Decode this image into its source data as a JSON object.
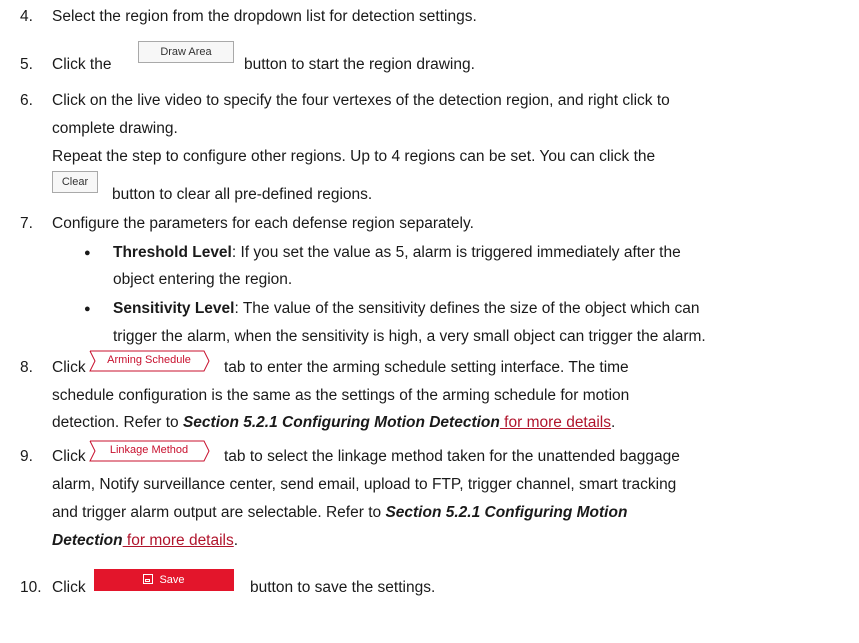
{
  "steps": {
    "s4": {
      "num": "4.",
      "text": "Select the region from the dropdown list for detection settings."
    },
    "s5": {
      "num": "5.",
      "pre": "Click the",
      "button": "Draw Area",
      "post": "button to start the region drawing."
    },
    "s6": {
      "num": "6.",
      "line1": "Click on the live video to specify the four vertexes of the detection region, and right click to",
      "line2": "complete drawing.",
      "line3": "Repeat the step to configure other regions. Up to 4 regions can be set. You can click the",
      "clear_button": "Clear",
      "line4": "button to clear all pre-defined regions."
    },
    "s7": {
      "num": "7.",
      "text": "Configure the parameters for each defense region separately.",
      "bullets": [
        {
          "term": "Threshold Level",
          "line1": ": If you set the value as 5, alarm is triggered immediately after the",
          "line2": "object entering the region."
        },
        {
          "term": "Sensitivity Level",
          "line1": ": The value of the sensitivity defines the size of the object which can",
          "line2": "trigger the alarm, when the sensitivity is high, a very small object can trigger the alarm."
        }
      ]
    },
    "s8": {
      "num": "8.",
      "pre": "Click",
      "tab": "Arming Schedule",
      "line1": "tab to enter the arming schedule setting interface. The time",
      "line2": "schedule configuration is the same as the settings of the arming schedule for motion",
      "line3_pre": "detection. Refer to ",
      "ref": "Section 5.2.1 Configuring Motion Detection",
      "link": " for more details",
      "end": "."
    },
    "s9": {
      "num": "9.",
      "pre": "Click",
      "tab": "Linkage Method",
      "line1": "tab to select the linkage method taken for the unattended baggage",
      "line2": "alarm, Notify surveillance center, send email, upload to FTP, trigger channel, smart tracking",
      "line3_pre": "and trigger alarm output are selectable. Refer to ",
      "ref_a": "Section 5.2.1 Configuring Motion",
      "ref_b": "Detection",
      "link": " for more details",
      "end": "."
    },
    "s10": {
      "num": "10.",
      "pre": "Click",
      "button": "Save",
      "button_icon": "save-icon",
      "post": "button to save the settings."
    }
  },
  "colors": {
    "link": "#b0142c",
    "save_button": "#e3152b",
    "tab_text": "#c8102e"
  }
}
